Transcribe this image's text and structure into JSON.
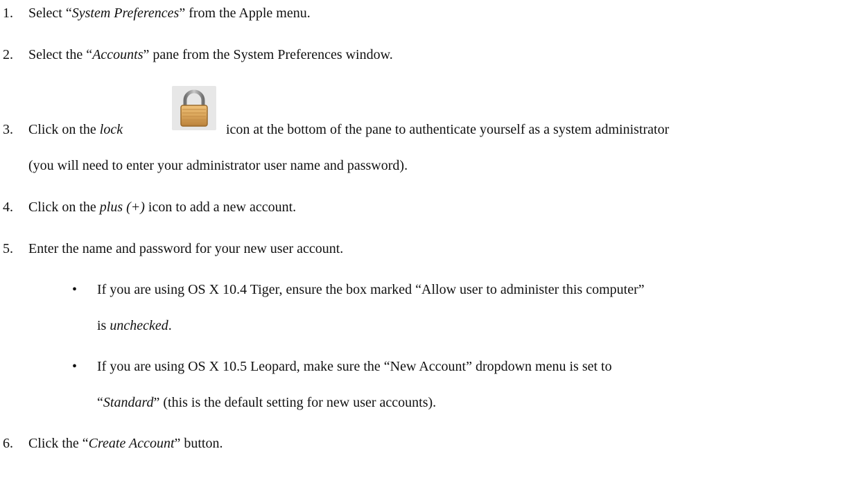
{
  "steps": [
    {
      "number": "1.",
      "parts": [
        "Select “",
        "System Preferences",
        "” from the Apple menu."
      ]
    },
    {
      "number": "2.",
      "parts": [
        "Select the “",
        "Accounts",
        "” pane from the System Preferences window."
      ]
    },
    {
      "number": "3.",
      "parts": [
        "Click on the ",
        "lock",
        " icon at the bottom of the pane to authenticate yourself as a system administrator"
      ],
      "continuation": "(you will need to enter your administrator user name and password).",
      "icon": "lock-icon"
    },
    {
      "number": "4.",
      "parts": [
        "Click on the ",
        "plus (+)",
        " icon to add a new account."
      ]
    },
    {
      "number": "5.",
      "text": "Enter the name and password for your new user account."
    },
    {
      "number": "6.",
      "parts": [
        "Click the “",
        "Create Account",
        "” button."
      ]
    }
  ],
  "bullets": [
    {
      "symbol": "•",
      "line1": "If you are using OS X 10.4 Tiger, ensure the box marked “Allow user to administer this computer”",
      "line2_parts": [
        "is ",
        "unchecked",
        "."
      ]
    },
    {
      "symbol": "•",
      "line1": "If you are using OS X 10.5 Leopard, make sure the “New Account” dropdown menu is set to",
      "line2_parts": [
        "“",
        "Standard",
        "” (this is the default setting for new user accounts)."
      ]
    }
  ],
  "colors": {
    "text": "#111111",
    "lock_body": "#d9a55a",
    "lock_shackle": "#8a8a8a",
    "icon_bg": "#e7e7e7"
  }
}
